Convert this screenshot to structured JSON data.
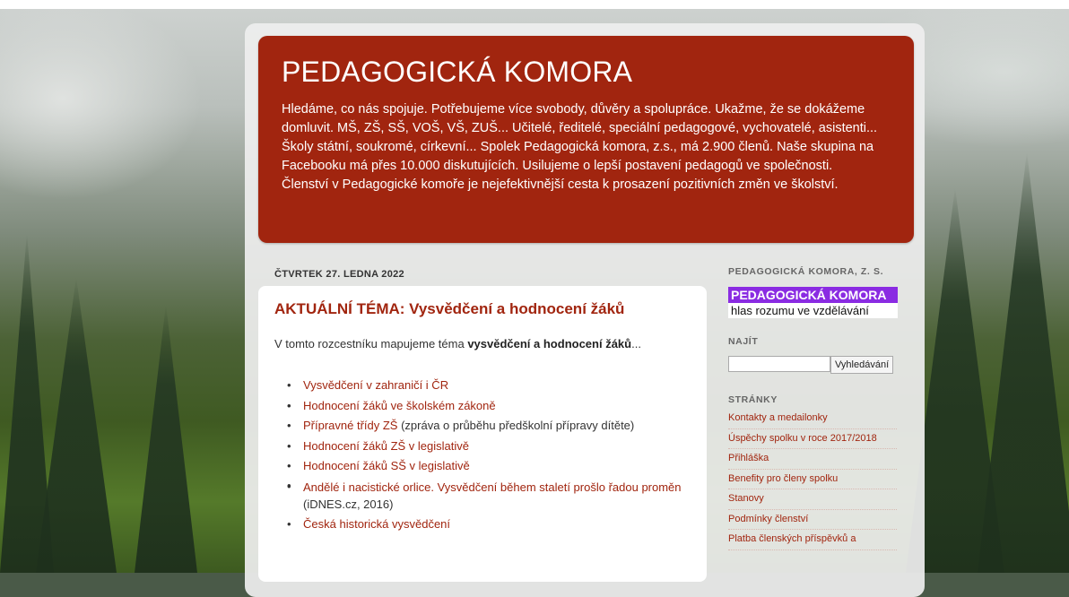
{
  "blog": {
    "title": "PEDAGOGICKÁ KOMORA",
    "description": "Hledáme, co nás spojuje. Potřebujeme více svobody, důvěry a spolupráce. Ukažme, že se dokážeme domluvit. MŠ, ZŠ, SŠ, VOŠ, VŠ, ZUŠ... Učitelé, ředitelé, speciální pedagogové, vychovatelé, asistenti... Školy státní, soukromé, církevní... Spolek Pedagogická komora, z.s., má 2.900 členů. Naše skupina na Facebooku má přes 10.000 diskutujících. Usilujeme o lepší postavení pedagogů ve společnosti. Členství v Pedagogické komoře je nejefektivnější cesta k prosazení pozitivních změn ve školství."
  },
  "post": {
    "date": "ČTVRTEK 27. LEDNA 2022",
    "title": "AKTUÁLNÍ TÉMA: Vysvědčení a hodnocení žáků",
    "intro_prefix": "V tomto rozcestníku mapujeme téma ",
    "intro_bold": "vysvědčení a hodnocení žáků",
    "intro_suffix": "...",
    "links": [
      {
        "text": "Vysvědčení v zahraničí i ČR",
        "note": ""
      },
      {
        "text": "",
        "note": ""
      },
      {
        "text": "Hodnocení žáků ve školském zákoně",
        "note": ""
      },
      {
        "text": "Přípravné třídy ZŠ",
        "note": " (zpráva o průběhu předškolní přípravy dítěte)"
      },
      {
        "text": "Hodnocení žáků ZŠ v legislativě",
        "note": ""
      },
      {
        "text": "Hodnocení žáků SŠ v legislativě",
        "note": ""
      },
      {
        "text": "",
        "note": ""
      },
      {
        "text": "Andělé i nacistické orlice. Vysvědčení během staletí prošlo řadou proměn",
        "note": " (iDNES.cz, 2016)"
      },
      {
        "text": "Česká historická vysvědčení",
        "note": ""
      }
    ]
  },
  "sidebar": {
    "org_heading": "PEDAGOGICKÁ KOMORA, Z. S.",
    "brand_name": "PEDAGOGICKÁ KOMORA",
    "brand_tagline": "hlas rozumu ve vzdělávání",
    "search_heading": "NAJÍT",
    "search_value": "",
    "search_button": "Vyhledávání",
    "pages_heading": "STRÁNKY",
    "pages": [
      "Kontakty a medailonky",
      "Úspěchy spolku v roce 2017/2018",
      "Přihláška",
      "Benefity pro členy spolku",
      "Stanovy",
      "Podmínky členství",
      "Platba členských příspěvků a"
    ]
  },
  "colors": {
    "accent": "#a1250f",
    "brand_purple": "#8a2be2"
  }
}
